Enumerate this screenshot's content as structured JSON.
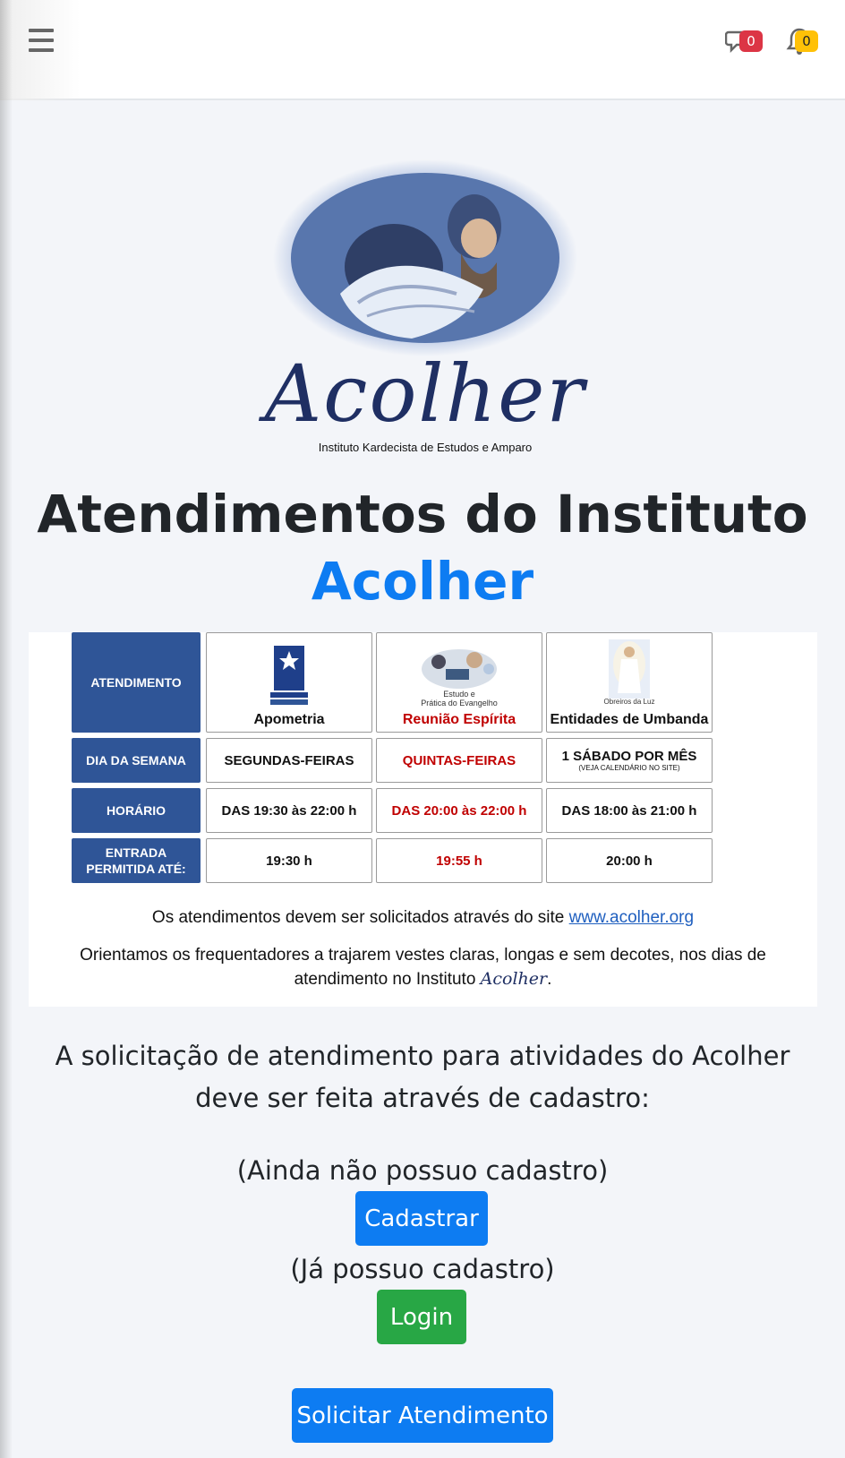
{
  "header": {
    "messages_count": "0",
    "notifications_count": "0"
  },
  "logo": {
    "brand": "Acolher",
    "subtitle": "Instituto Kardecista de Estudos e Amparo"
  },
  "page": {
    "title_line1": "Atendimentos do Instituto",
    "title_line2": "Acolher"
  },
  "schedule": {
    "row_headers": {
      "atendimento": "ATENDIMENTO",
      "dia": "DIA DA SEMANA",
      "horario": "HORÁRIO",
      "entrada_line1": "ENTRADA",
      "entrada_line2": "PERMITIDA ATÉ:"
    },
    "columns": [
      {
        "image_caption": "",
        "name": "Apometria",
        "dia": "SEGUNDAS-FEIRAS",
        "dia_note": "",
        "horario": "DAS 19:30 às 22:00 h",
        "entrada": "19:30 h"
      },
      {
        "image_caption_line1": "Estudo e",
        "image_caption_line2": "Prática do Evangelho",
        "name": "Reunião Espírita",
        "dia": "QUINTAS-FEIRAS",
        "horario": "DAS 20:00 às 22:00 h",
        "entrada": "19:55 h"
      },
      {
        "image_caption": "Obreiros da Luz",
        "name": "Entidades de Umbanda",
        "dia": "1 SÁBADO POR MÊS",
        "dia_note": "(VEJA CALENDÁRIO NO SITE)",
        "horario": "DAS 18:00 às 21:00 h",
        "entrada": "20:00 h"
      }
    ],
    "note_line1_prefix": "Os atendimentos devem ser solicitados através do site",
    "note_link": "www.acolher.org",
    "note_line2": "Orientamos os frequentadores a trajarem vestes claras, longas e sem decotes, nos dias de atendimento no Instituto",
    "note_brand": "Acolher",
    "note_end": "."
  },
  "main": {
    "info_text": "A solicitação de atendimento para atividades do Acolher deve ser feita através de cadastro:",
    "hint_no_account": "(Ainda não possuo cadastro)",
    "register_label": "Cadastrar",
    "hint_has_account": "(Já possuo cadastro)",
    "login_label": "Login",
    "request_label": "Solicitar Atendimento"
  }
}
